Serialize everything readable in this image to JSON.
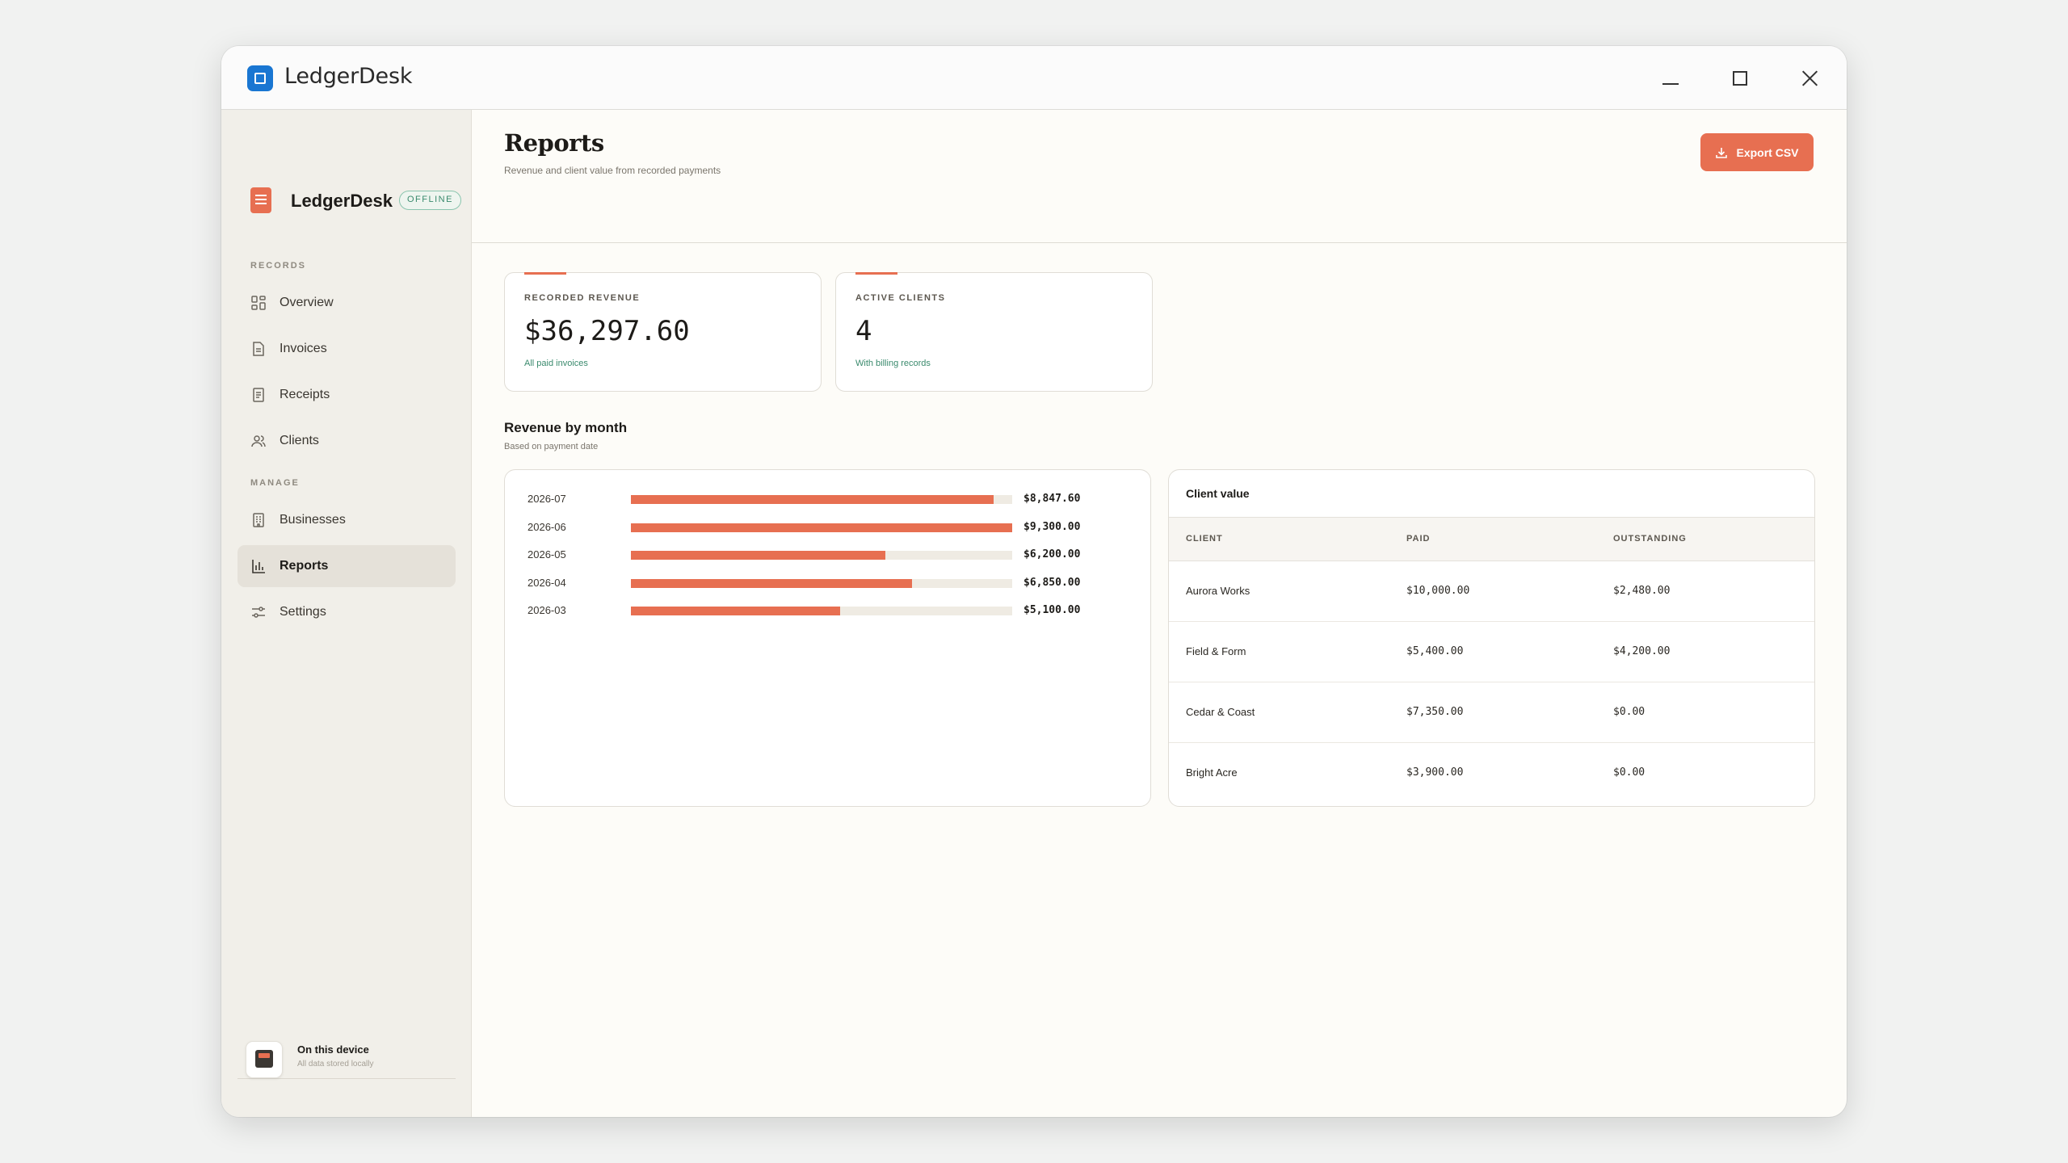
{
  "window": {
    "title": "LedgerDesk"
  },
  "sidebar": {
    "brand_name": "LedgerDesk",
    "badge": "OFFLINE",
    "sections": [
      {
        "label": "RECORDS"
      },
      {
        "label": "MANAGE"
      }
    ],
    "items": [
      {
        "label": "Overview",
        "icon": "grid-icon"
      },
      {
        "label": "Invoices",
        "icon": "document-icon"
      },
      {
        "label": "Receipts",
        "icon": "receipt-icon"
      },
      {
        "label": "Clients",
        "icon": "users-icon"
      },
      {
        "label": "Businesses",
        "icon": "building-icon"
      },
      {
        "label": "Reports",
        "icon": "bar-chart-icon",
        "active": true
      },
      {
        "label": "Settings",
        "icon": "sliders-icon"
      }
    ],
    "device": {
      "title": "On this device",
      "subtitle": "All data stored locally"
    }
  },
  "header": {
    "title": "Reports",
    "subtitle": "Revenue and client value from recorded payments",
    "export_label": "Export CSV"
  },
  "stats": [
    {
      "label": "RECORDED REVENUE",
      "value": "$36,297.60",
      "note": "All paid invoices"
    },
    {
      "label": "ACTIVE CLIENTS",
      "value": "4",
      "note": "With billing records"
    }
  ],
  "revenue_section": {
    "title": "Revenue by month",
    "subtitle": "Based on payment date"
  },
  "chart_data": {
    "type": "bar",
    "orientation": "horizontal",
    "categories": [
      "2026-07",
      "2026-06",
      "2026-05",
      "2026-04",
      "2026-03"
    ],
    "values": [
      8847.6,
      9300.0,
      6200.0,
      6850.0,
      5100.0
    ],
    "value_labels": [
      "$8,847.60",
      "$9,300.00",
      "$6,200.00",
      "$6,850.00",
      "$5,100.00"
    ],
    "xlim": [
      0,
      9300
    ],
    "color": "#e76f51",
    "track_color": "#efebe3",
    "grid": false
  },
  "client_table": {
    "title": "Client value",
    "columns": [
      "CLIENT",
      "PAID",
      "OUTSTANDING"
    ],
    "rows": [
      [
        "Aurora Works",
        "$10,000.00",
        "$2,480.00"
      ],
      [
        "Field & Form",
        "$5,400.00",
        "$4,200.00"
      ],
      [
        "Cedar & Coast",
        "$7,350.00",
        "$0.00"
      ],
      [
        "Bright Acre",
        "$3,900.00",
        "$0.00"
      ]
    ]
  },
  "colors": {
    "accent": "#e76f51",
    "success": "#3a8a6d",
    "brand_icon": "#1976d2"
  }
}
